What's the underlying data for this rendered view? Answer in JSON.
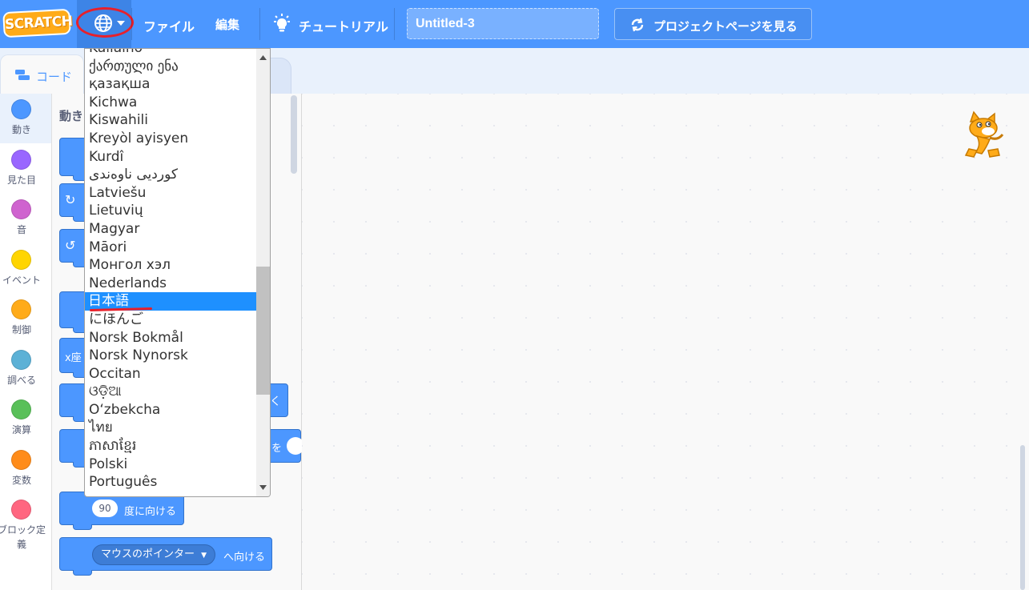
{
  "menubar": {
    "logo_text": "SCRATCH",
    "file_label": "ファイル",
    "edit_label": "編集",
    "tutorial_label": "チュートリアル",
    "project_title": "Untitled-3",
    "see_project_label": "プロジェクトページを見る",
    "accent_color": "#4c97ff",
    "annotation_color": "#e8202a"
  },
  "tabs": {
    "code_label": "コード"
  },
  "categories": [
    {
      "label": "動き",
      "color": "#4c97ff"
    },
    {
      "label": "見た目",
      "color": "#9966ff"
    },
    {
      "label": "音",
      "color": "#cf63cf"
    },
    {
      "label": "イベント",
      "color": "#ffd500"
    },
    {
      "label": "制御",
      "color": "#ffab19"
    },
    {
      "label": "調べる",
      "color": "#5cb1d6"
    },
    {
      "label": "演算",
      "color": "#59c059"
    },
    {
      "label": "変数",
      "color": "#ff8c1a"
    },
    {
      "label": "ブロック定義",
      "color": "#ff6680"
    }
  ],
  "palette": {
    "heading": "動き",
    "partial_x": "x座",
    "partial_ku": "く",
    "partial_wo": "を",
    "point_direction_value": "90",
    "point_direction_label": "度に向ける",
    "point_towards_option": "マウスのポインター",
    "point_towards_label": "へ向ける"
  },
  "language_menu": {
    "items": [
      "Kaliaino",
      "ქართული ენა",
      "қазақша",
      "Kichwa",
      "Kiswahili",
      "Kreyòl ayisyen",
      "Kurdî",
      "کوردیی ناوەندی",
      "Latviešu",
      "Lietuvių",
      "Magyar",
      "Māori",
      "Монгол хэл",
      "Nederlands",
      "日本語",
      "にほんご",
      "Norsk Bokmål",
      "Norsk Nynorsk",
      "Occitan",
      "ଓଡ଼ିଆ",
      "Oʻzbekcha",
      "ไทย",
      "ភាសាខ្មែរ",
      "Polski",
      "Português"
    ],
    "selected": "日本語",
    "selected_color": "#1e90ff"
  }
}
